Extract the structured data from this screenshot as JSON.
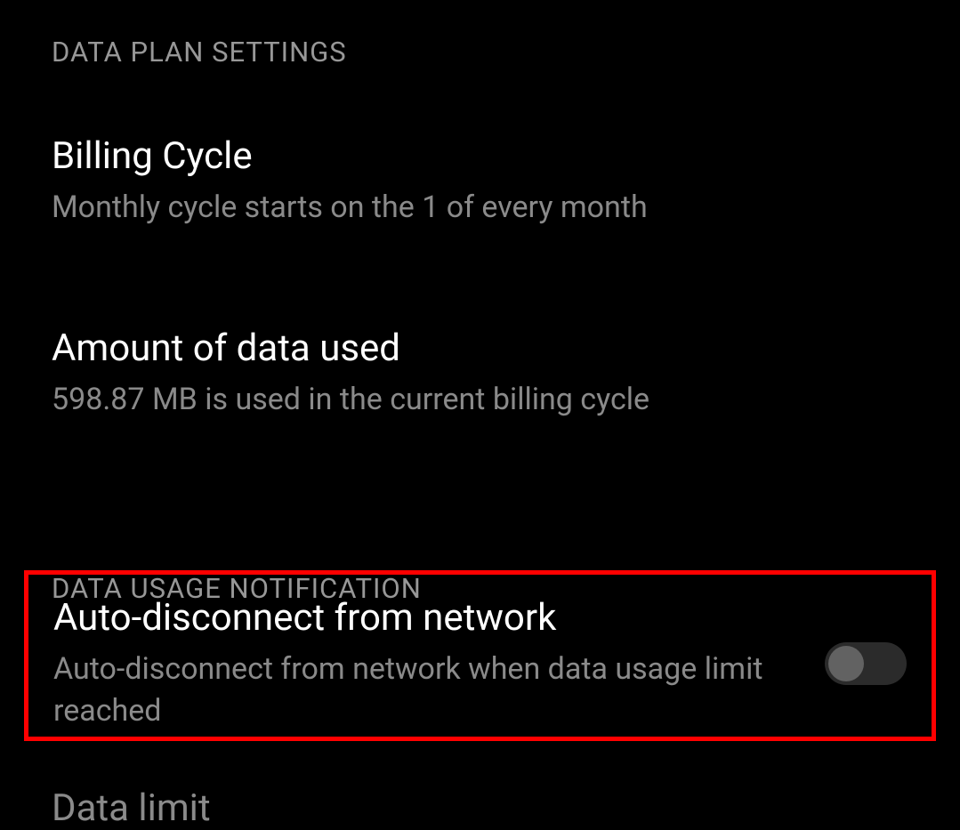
{
  "sections": {
    "data_plan": {
      "header": "DATA PLAN SETTINGS",
      "billing_cycle": {
        "title": "Billing Cycle",
        "subtitle": "Monthly cycle starts on the 1 of every month"
      },
      "amount_used": {
        "title": "Amount of data used",
        "subtitle": " 598.87 MB is used in the current billing cycle"
      }
    },
    "data_usage_notification": {
      "header": "DATA USAGE NOTIFICATION",
      "auto_disconnect": {
        "title": "Auto-disconnect from network",
        "subtitle": "Auto-disconnect from network when data usage limit reached",
        "toggle_on": false
      },
      "data_limit": {
        "title": "Data limit"
      }
    }
  }
}
